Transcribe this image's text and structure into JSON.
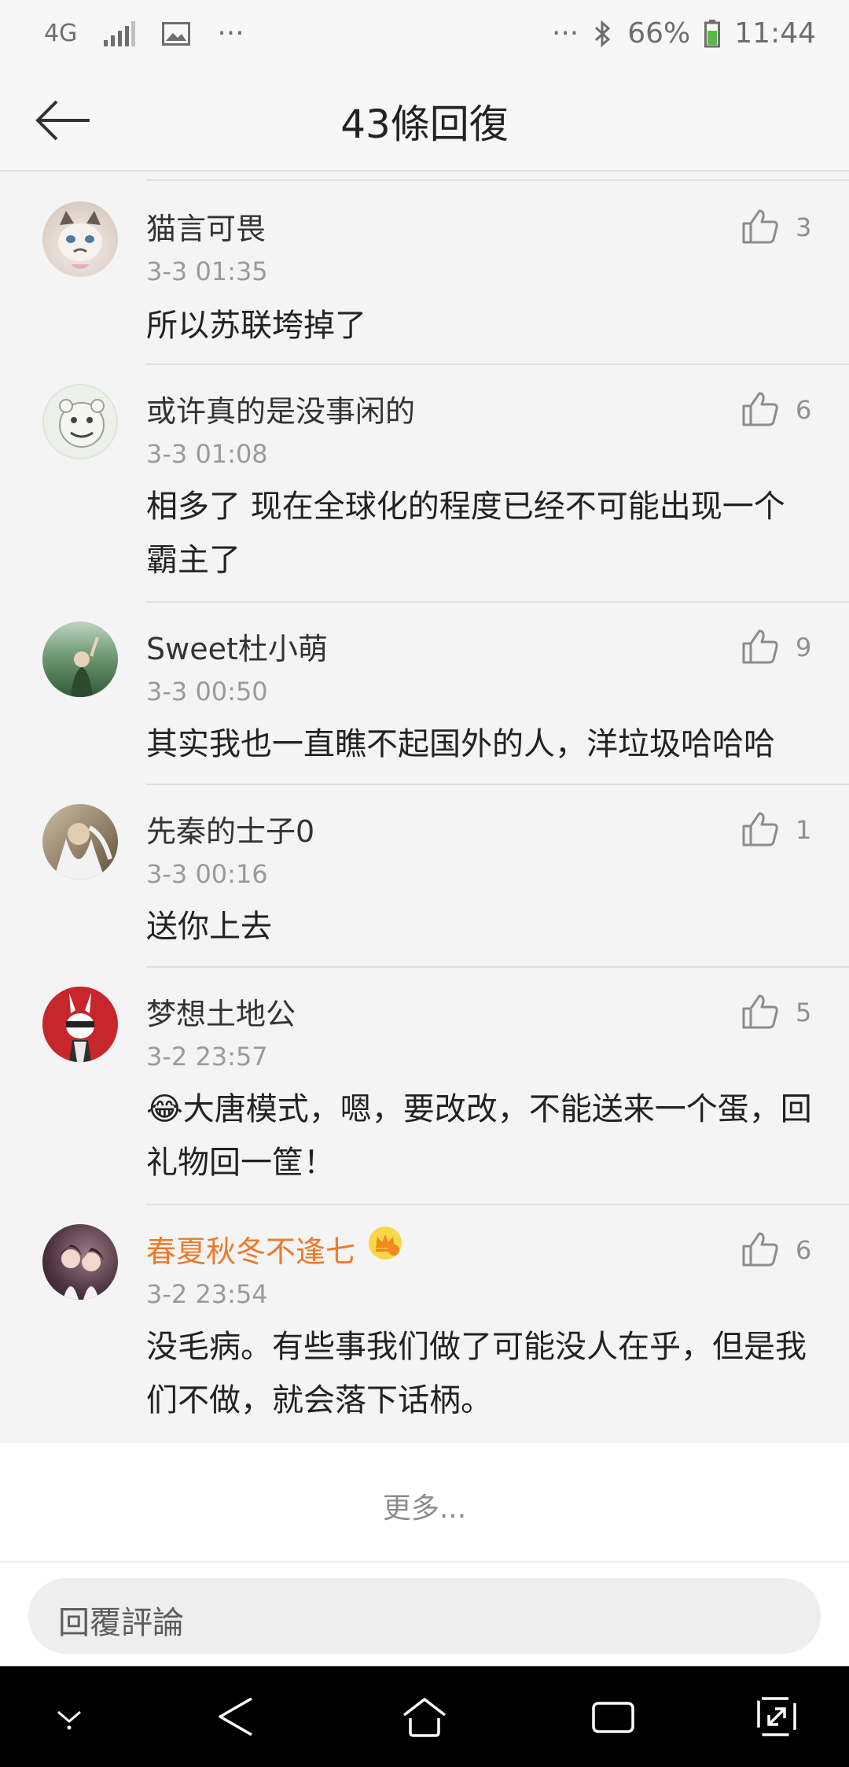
{
  "status_bar": {
    "network": "4G",
    "more_left": "···",
    "more_right": "···",
    "battery": "66%",
    "time": "11:44"
  },
  "header": {
    "title": "43條回復"
  },
  "replies": [
    {
      "name": "猫言可畏",
      "time": "3-3 01:35",
      "text": "所以苏联垮掉了",
      "likes": "3",
      "vip": false
    },
    {
      "name": "或许真的是没事闲的",
      "time": "3-3 01:08",
      "text": "相多了  现在全球化的程度已经不可能出现一个霸主了",
      "likes": "6",
      "vip": false
    },
    {
      "name": "Sweet杜小萌",
      "time": "3-3 00:50",
      "text": "其实我也一直瞧不起国外的人，洋垃圾哈哈哈",
      "likes": "9",
      "vip": false
    },
    {
      "name": "先秦的士子0",
      "time": "3-3 00:16",
      "text": "送你上去",
      "likes": "1",
      "vip": false
    },
    {
      "name": "梦想土地公",
      "time": "3-2 23:57",
      "text": "😂大唐模式，嗯，要改改，不能送来一个蛋，回礼物回一筐！",
      "likes": "5",
      "vip": false
    },
    {
      "name": "春夏秋冬不逢七",
      "time": "3-2 23:54",
      "text": "没毛病。有些事我们做了可能没人在乎，但是我们不做，就会落下话柄。",
      "likes": "6",
      "vip": true
    }
  ],
  "more_label": "更多...",
  "reply_placeholder": "回覆評論",
  "colors": {
    "vip_name": "#ec7a2b",
    "background": "#f4f4f4",
    "navbar": "#000000"
  },
  "icons": [
    "back-arrow-icon",
    "thumbs-up-icon",
    "crown-badge-icon",
    "bluetooth-icon",
    "battery-icon",
    "signal-icon",
    "image-icon",
    "nav-down-icon",
    "nav-back-icon",
    "nav-home-icon",
    "nav-recents-icon",
    "nav-expand-icon"
  ]
}
